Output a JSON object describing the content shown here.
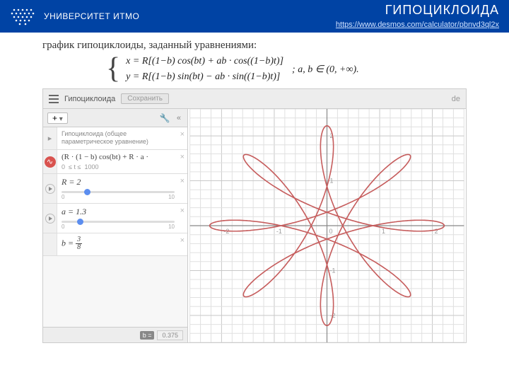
{
  "header": {
    "university": "УНИВЕРСИТЕТ ИТМО",
    "title": "ГИПОЦИКЛОИДА",
    "link": "https://www.desmos.com/calculator/pbnvd3ql2x"
  },
  "subtitle": "график  гипоциклоиды, заданный уравнениями:",
  "equations": {
    "x": "x = R[(1−b) cos(bt) + ab · cos((1−b)t)]",
    "y": "y = R[(1−b) sin(bt) − ab · sin((1−b)t)]",
    "tail": "; a, b ∈ (0, +∞)."
  },
  "calc": {
    "doc_title": "Гипоциклоида",
    "share_label": "Сохранить",
    "brand": "de",
    "add_label": "+",
    "folder": {
      "title": "Гипоциклоида (общее параметрическое уравнение)"
    },
    "expr1": {
      "formula": "(R · (1 − b) cos(bt) + R · a ·",
      "domain_lo": "0",
      "domain_mid": "≤ t ≤",
      "domain_hi": "1000"
    },
    "sliderR": {
      "label": "R = 2",
      "lo": "0",
      "hi": "10",
      "pos": 0.2
    },
    "sliderA": {
      "label": "a = 1.3",
      "lo": "0",
      "hi": "10",
      "pos": 0.14
    },
    "sliderB": {
      "num": "3",
      "den": "8",
      "prefix": "b = "
    },
    "footer": {
      "label": "b =",
      "value": "0.375"
    }
  },
  "chart_data": {
    "type": "parametric-line",
    "title": "",
    "xlim": [
      -2.6,
      2.6
    ],
    "ylim": [
      -2.6,
      2.6
    ],
    "xticks": [
      -2,
      -1,
      0,
      1,
      2
    ],
    "yticks": [
      -2,
      -1,
      1,
      2
    ],
    "params": {
      "R": 2,
      "a": 1.3,
      "b": 0.375
    },
    "t_range": [
      0,
      1000
    ],
    "series_color": "#c65d5d",
    "grid": true
  }
}
